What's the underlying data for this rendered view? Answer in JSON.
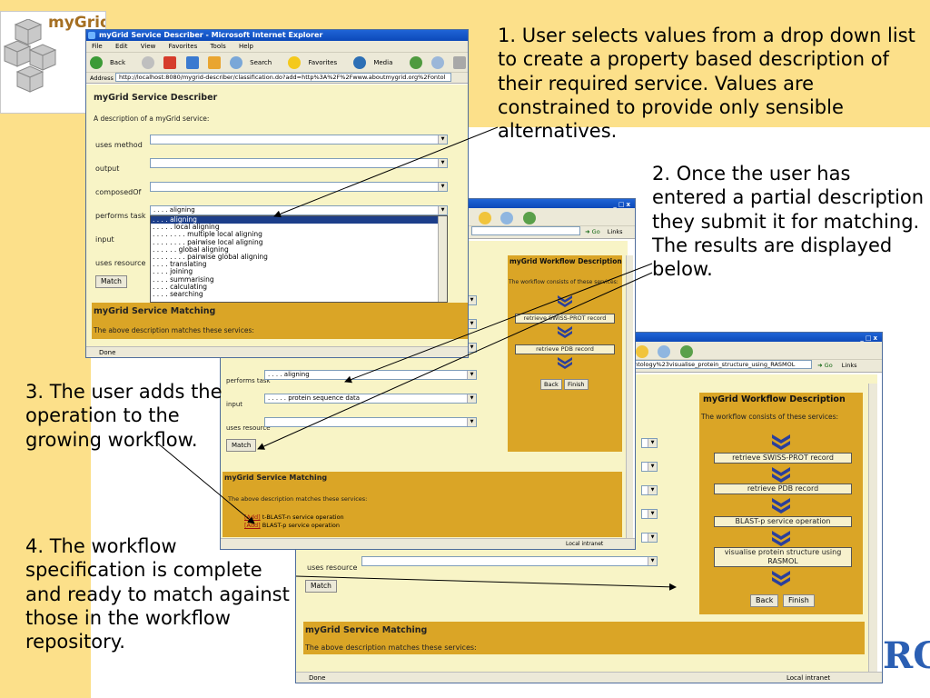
{
  "logo": {
    "text": "myGrid"
  },
  "annotations": {
    "a1": "1. User selects values from a drop down list to create a property based description of their required service. Values are constrained to provide only sensible alternatives.",
    "a2": "2.  Once the user has entered a partial description they submit it for matching. The results are displayed below.",
    "a3": "3. The user adds the operation to the growing workflow.",
    "a4": "4.  The workflow specification is complete and ready to match against those in the workflow repository."
  },
  "window1": {
    "title": "myGrid Service Describer - Microsoft Internet Explorer",
    "menu": [
      "File",
      "Edit",
      "View",
      "Favorites",
      "Tools",
      "Help"
    ],
    "toolbar": [
      "Back",
      "Search",
      "Favorites",
      "Media"
    ],
    "address_label": "Address",
    "address": "http://localhost:8080/mygrid-describer/classification.do?add=http%3A%2F%2Fwww.aboutmygrid.org%2Fontol",
    "page_title": "myGrid Service Describer",
    "description": "A description of a myGrid service:",
    "fields": [
      "uses method",
      "output",
      "composedOf",
      "performs task",
      "input",
      "uses resource"
    ],
    "performs_task_value": ". . . . aligning",
    "dropdown_options": [
      ". . . . aligning",
      ". . . . . local aligning",
      ". . . . . . . . multiple local aligning",
      ". . . . . . . . pairwise local aligning",
      ". . . . . . global aligning",
      ". . . . . . . . pairwise global aligning",
      ". . . . translating",
      ". . . . joining",
      ". . . . summarising",
      ". . . . calculating",
      ". . . . searching"
    ],
    "match_button": "Match",
    "matching_title": "myGrid Service Matching",
    "matching_text": "The above description matches these services:",
    "status": "Done"
  },
  "window2": {
    "address_tail": "Go",
    "links": "Links",
    "fields": [
      "performs task",
      "input",
      "uses resource"
    ],
    "performs_task_value": ". . . . aligning",
    "input_value": ". . . . . protein sequence data",
    "match_button": "Match",
    "wf_title": "myGrid Workflow Description",
    "wf_sub": "The workflow consists of these services:",
    "wf_steps": [
      "retrieve SWISS-PROT record",
      "retrieve PDB record"
    ],
    "back": "Back",
    "finish": "Finish",
    "matching_title": "myGrid Service Matching",
    "matching_text": "The above description matches these services:",
    "results": [
      {
        "add": "[Add]",
        "name": "t-BLAST-n service operation"
      },
      {
        "add": "[Add]",
        "name": "BLAST-p service operation"
      }
    ],
    "zone": "Local intranet"
  },
  "window3": {
    "address": "ntology%23visualise_protein_structure_using_RASMOL",
    "go": "Go",
    "links": "Links",
    "wf_title": "myGrid Workflow Description",
    "wf_sub": "The workflow consists of these services:",
    "wf_steps": [
      "retrieve SWISS-PROT record",
      "retrieve PDB record",
      "BLAST-p service operation",
      "visualise protein structure using RASMOL"
    ],
    "uses_resource": "uses resource",
    "match_button": "Match",
    "back": "Back",
    "finish": "Finish",
    "matching_title": "myGrid Service Matching",
    "matching_text": "The above description matches these services:",
    "status": "Done",
    "zone": "Local intranet"
  },
  "corner_logo": {
    "text": "RC"
  },
  "colors": {
    "background_band": "#fce08a",
    "gold": "#daa526",
    "content_bg": "#f8f4c6",
    "titlebar": "#0c49b9"
  }
}
